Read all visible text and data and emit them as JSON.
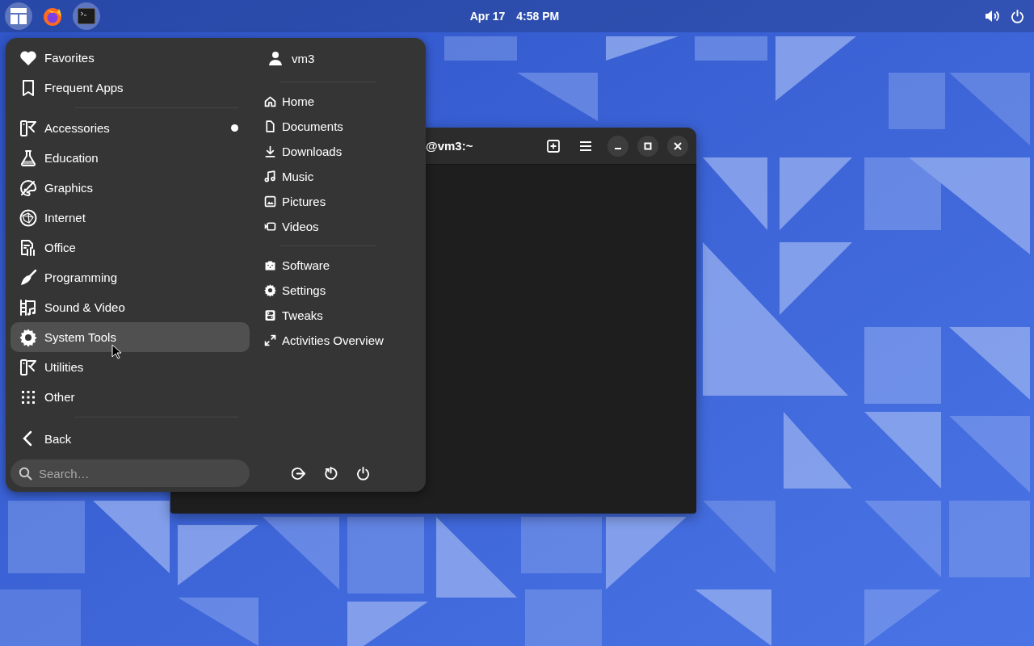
{
  "top_bar": {
    "date": "Apr 17",
    "time": "4:58 PM"
  },
  "terminal": {
    "title": "@vm3:~"
  },
  "menu": {
    "shortcuts": [
      {
        "label": "Favorites",
        "selected": false,
        "new": false
      },
      {
        "label": "Frequent Apps",
        "selected": false,
        "new": false
      }
    ],
    "categories": [
      {
        "label": "Accessories",
        "selected": false,
        "new": true
      },
      {
        "label": "Education",
        "selected": false,
        "new": false
      },
      {
        "label": "Graphics",
        "selected": false,
        "new": false
      },
      {
        "label": "Internet",
        "selected": false,
        "new": false
      },
      {
        "label": "Office",
        "selected": false,
        "new": false
      },
      {
        "label": "Programming",
        "selected": false,
        "new": false
      },
      {
        "label": "Sound & Video",
        "selected": false,
        "new": false
      },
      {
        "label": "System Tools",
        "selected": true,
        "new": false
      },
      {
        "label": "Utilities",
        "selected": false,
        "new": false
      },
      {
        "label": "Other",
        "selected": false,
        "new": false
      }
    ],
    "back": "Back",
    "search": {
      "placeholder": "Search…"
    },
    "user": "vm3",
    "places": [
      "Home",
      "Documents",
      "Downloads",
      "Music",
      "Pictures",
      "Videos"
    ],
    "apps": [
      "Software",
      "Settings",
      "Tweaks",
      "Activities Overview"
    ]
  }
}
